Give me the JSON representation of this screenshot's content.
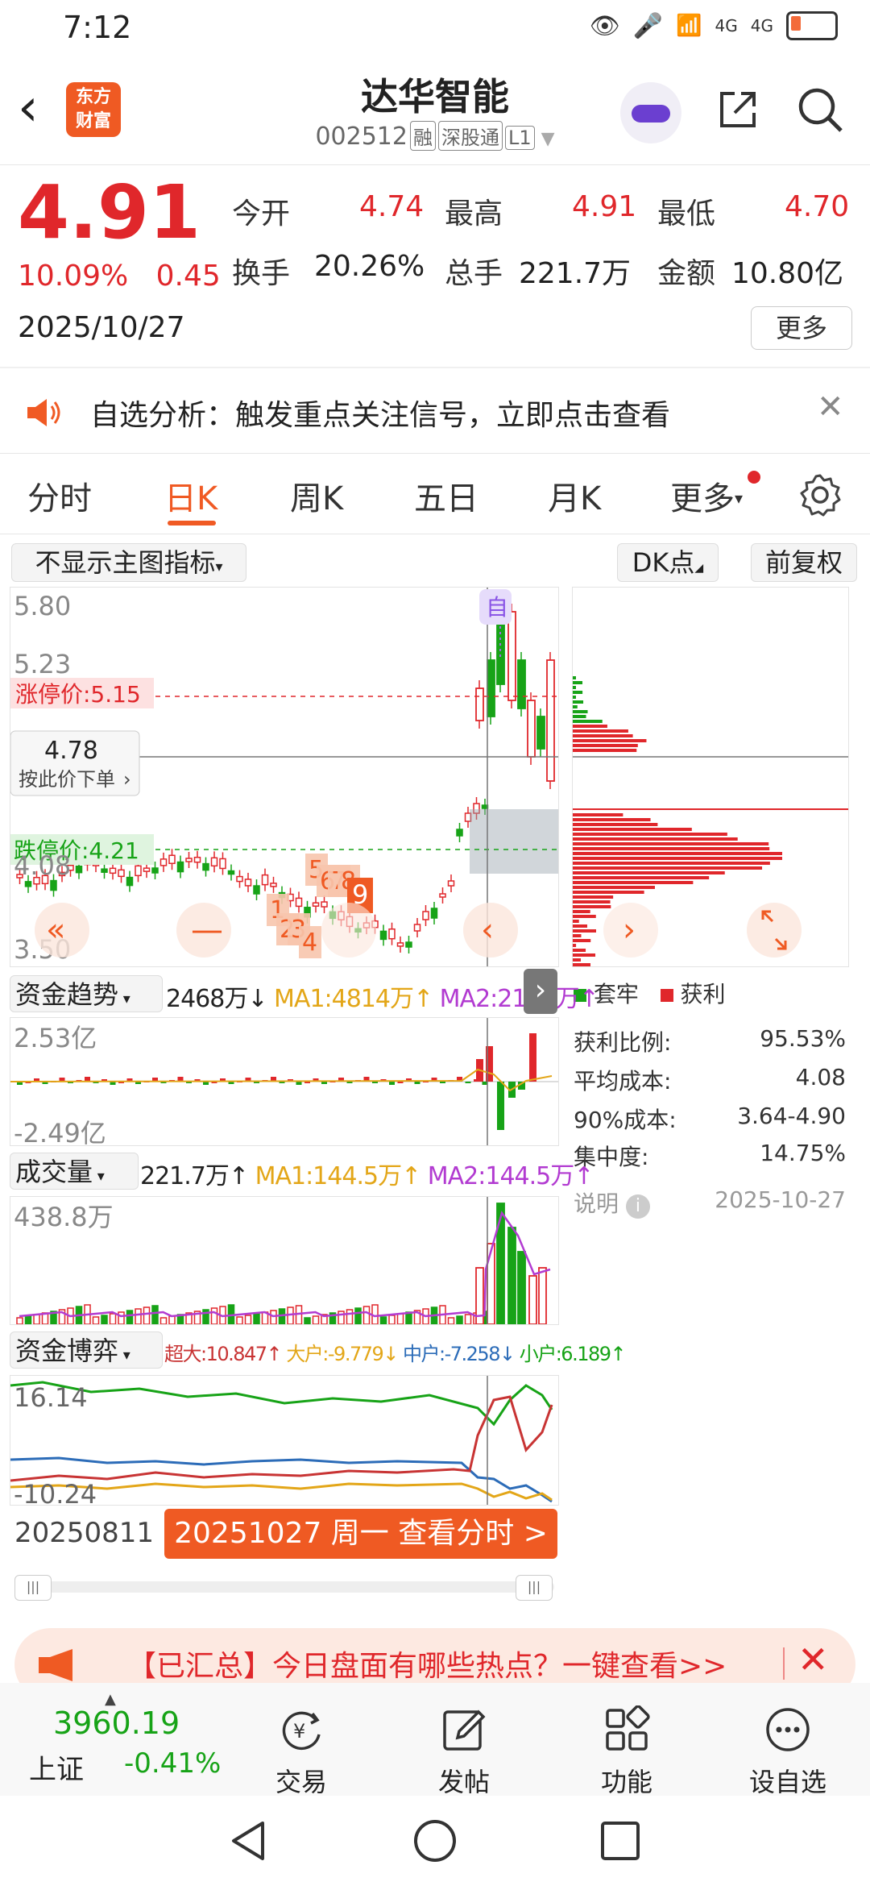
{
  "status": {
    "time": "7:12",
    "signal1": "4G",
    "signal2": "4G"
  },
  "header": {
    "app_logo_text_line1": "东方",
    "app_logo_text_line2": "财富",
    "stock_name": "达华智能",
    "stock_code": "002512",
    "tags": [
      "融",
      "深股通",
      "L1"
    ]
  },
  "quote": {
    "price": "4.91",
    "change_pct": "10.09%",
    "change_amt": "0.45",
    "date": "2025/10/27",
    "open_label": "今开",
    "open": "4.74",
    "high_label": "最高",
    "high": "4.91",
    "low_label": "最低",
    "low": "4.70",
    "turnover_label": "换手",
    "turnover": "20.26%",
    "volume_label": "总手",
    "volume": "221.7万",
    "amount_label": "金额",
    "amount": "10.80亿",
    "more_label": "更多"
  },
  "notice": {
    "text": "自选分析：触发重点关注信号，立即点击查看"
  },
  "tabs": [
    {
      "label": "分时"
    },
    {
      "label": "日K"
    },
    {
      "label": "周K"
    },
    {
      "label": "五日"
    },
    {
      "label": "月K"
    },
    {
      "label": "更多"
    }
  ],
  "main_chart": {
    "indicator_select": "不显示主图指标",
    "dk_label": "DK点",
    "adjust_label": "前复权",
    "y_top": "5.80",
    "y_523": "5.23",
    "limit_up": "涨停价:5.15",
    "crosshair_price": "4.78",
    "order_at_price": "按此价下单",
    "limit_down": "跌停价:4.21",
    "y_408": "4.08",
    "y_bottom": "3.50",
    "signal_marker": "自",
    "num_labels": [
      "1",
      "2",
      "3",
      "4",
      "5",
      "6",
      "7",
      "8",
      "9"
    ]
  },
  "distribution": {
    "legend_trapped": "套牢",
    "legend_profit": "获利",
    "profit_ratio_label": "获利比例:",
    "profit_ratio": "95.53%",
    "avg_cost_label": "平均成本:",
    "avg_cost": "4.08",
    "cost90_label": "90%成本:",
    "cost90": "3.64-4.90",
    "concentration_label": "集中度:",
    "concentration": "14.75%",
    "explain_label": "说明",
    "date": "2025-10-27"
  },
  "fund_trend": {
    "title": "资金趋势",
    "value": "2468万↓",
    "ma1": "MA1:4814万↑",
    "ma2": "MA2:2184万↑",
    "y_top": "2.53亿",
    "y_bottom": "-2.49亿"
  },
  "volume": {
    "title": "成交量",
    "value": "221.7万↑",
    "ma1": "MA1:144.5万↑",
    "ma2": "MA2:144.5万↑",
    "y_top": "438.8万"
  },
  "fund_game": {
    "title": "资金博弈",
    "super_large": "超大:10.847↑",
    "large": "大户:-9.779↓",
    "medium": "中户:-7.258↓",
    "small": "小户:6.189↑",
    "y_top": "16.14",
    "y_bottom": "-10.24"
  },
  "timeline": {
    "start_date": "20250811",
    "action": "20251027 周一 查看分时 >"
  },
  "banner": {
    "text": "【已汇总】今日盘面有哪些热点？一键查看>>"
  },
  "bottom_nav": {
    "index_value": "3960.19",
    "index_name": "上证",
    "index_change": "-0.41%",
    "trade": "交易",
    "post": "发帖",
    "function": "功能",
    "set_watch": "设自选"
  },
  "colors": {
    "up": "#e0272b",
    "down": "#17a317",
    "accent": "#ef5a23"
  }
}
